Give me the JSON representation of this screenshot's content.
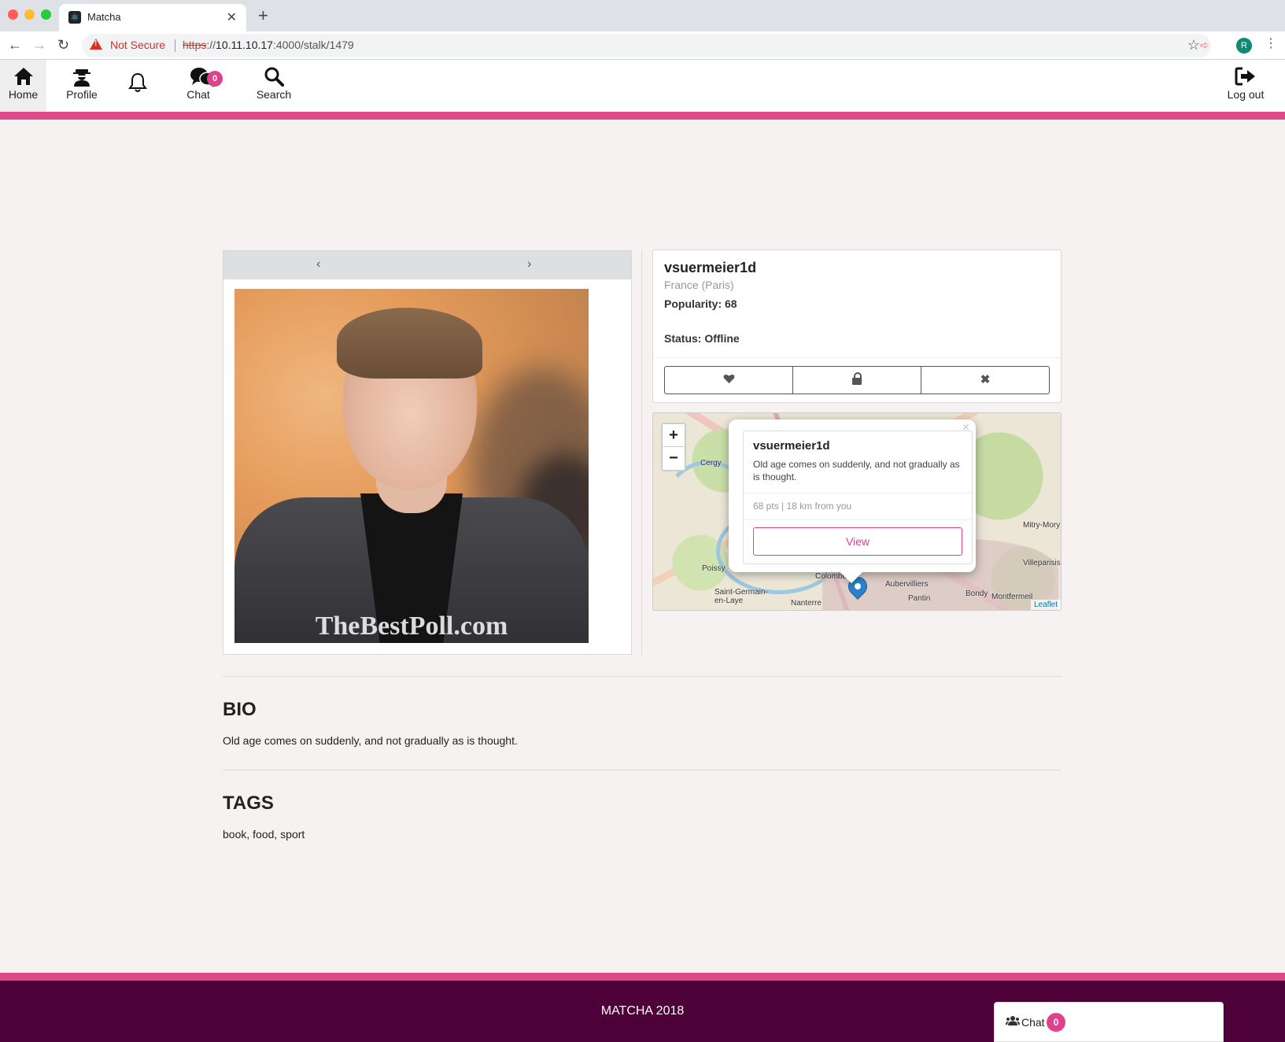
{
  "browser": {
    "tab_title": "Matcha",
    "tab_favicon": "react-icon",
    "security_label": "Not Secure",
    "url_scheme": "https",
    "url_host": "10.11.10.17",
    "url_rest": ":4000/stalk/1479",
    "profile_initial": "R"
  },
  "nav": {
    "home": "Home",
    "profile": "Profile",
    "chat": "Chat",
    "chat_badge": "0",
    "search": "Search",
    "logout": "Log out"
  },
  "colors": {
    "accent_pink": "#e0498a",
    "footer_bg": "#4d0138",
    "page_bg": "#f6f2f2"
  },
  "profile": {
    "username": "vsuermeier1d",
    "location": "France (Paris)",
    "popularity": "Popularity: 68",
    "status": "Status: Offline",
    "photo_watermark": "TheBestPoll.com"
  },
  "actions": {
    "like_icon": "heart-icon",
    "block_icon": "lock-icon",
    "dismiss_icon": "close-icon"
  },
  "map": {
    "zoom_in": "+",
    "zoom_out": "−",
    "attribution": "Leaflet",
    "places": [
      "Cergy",
      "Poissy",
      "Saint-Germain-en-Laye",
      "Nanterre",
      "Colombes",
      "Aubervilliers",
      "Pantin",
      "Bondy",
      "Montfermeil",
      "Villeparisis",
      "Mitry-Mory"
    ],
    "popup": {
      "name": "vsuermeier1d",
      "bio": "Old age comes on suddenly, and not gradually as is thought.",
      "meta": "68 pts | 18 km from you",
      "view_label": "View",
      "close": "×"
    }
  },
  "bio": {
    "title": "BIO",
    "text": "Old age comes on suddenly, and not gradually as is thought."
  },
  "tags": {
    "title": "TAGS",
    "text": "book, food, sport"
  },
  "footer": {
    "text": "MATCHA 2018",
    "chat_label": "Chat",
    "chat_badge": "0"
  }
}
